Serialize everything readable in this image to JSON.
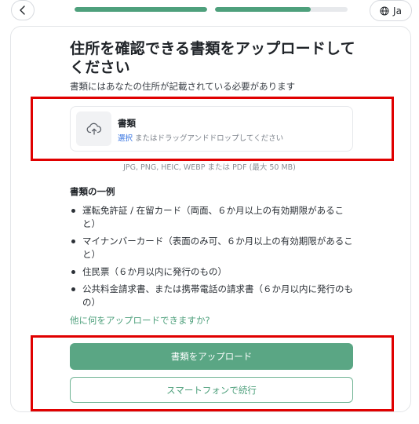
{
  "header": {
    "back_icon": "chevron-left-icon",
    "progress": [
      1.0,
      0.72
    ],
    "language_label": "Ja",
    "language_icon": "globe-icon"
  },
  "main": {
    "title": "住所を確認できる書類をアップロードしてください",
    "subtitle": "書類にはあなたの住所が記載されている必要があります",
    "upload": {
      "icon": "cloud-upload-icon",
      "label": "書類",
      "select_link": "選択",
      "hint_rest": " またはドラッグアンドドロップしてください"
    },
    "formats": "JPG, PNG, HEIC, WEBP または PDF (最大 50 MB)",
    "examples_heading": "書類の一例",
    "examples": [
      "運転免許証 / 在留カード（両面、６か月以上の有効期限があること）",
      "マイナンバーカード（表面のみ可、６か月以上の有効期限があること）",
      "住民票（６か月以内に発行のもの）",
      "公共料金請求書、または携帯電話の請求書（６か月以内に発行のもの）"
    ],
    "more_link": "他に何をアップロードできますか?",
    "primary_button": "書類をアップロード",
    "secondary_button": "スマートフォンで続行"
  },
  "colors": {
    "accent": "#4ea07c",
    "primary_button": "#5aa684",
    "link_blue": "#2f6fe0",
    "annotation_red": "#e00000"
  }
}
